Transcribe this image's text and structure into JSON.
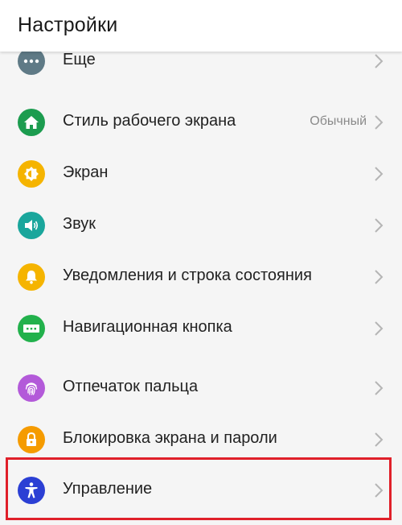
{
  "header": {
    "title": "Настройки"
  },
  "rows": [
    {
      "label": "Еще",
      "value": "",
      "icon": "more-dots-icon",
      "color": "#5f7a86"
    },
    {
      "label": "Стиль рабочего экрана",
      "value": "Обычный",
      "icon": "home-icon",
      "color": "#1c9c4f"
    },
    {
      "label": "Экран",
      "value": "",
      "icon": "brightness-icon",
      "color": "#f5b400"
    },
    {
      "label": "Звук",
      "value": "",
      "icon": "speaker-icon",
      "color": "#1aa69c"
    },
    {
      "label": "Уведомления и строка состояния",
      "value": "",
      "icon": "bell-icon",
      "color": "#f5b400"
    },
    {
      "label": "Навигационная кнопка",
      "value": "",
      "icon": "nav-bar-icon",
      "color": "#22b14c"
    },
    {
      "label": "Отпечаток пальца",
      "value": "",
      "icon": "fingerprint-icon",
      "color": "#b35ad9"
    },
    {
      "label": "Блокировка экрана и пароли",
      "value": "",
      "icon": "lock-icon",
      "color": "#f59b00"
    },
    {
      "label": "Управление",
      "value": "",
      "icon": "accessibility-icon",
      "color": "#2b3fd4"
    }
  ],
  "highlight": {
    "color": "#e0202a",
    "target": "Управление"
  }
}
